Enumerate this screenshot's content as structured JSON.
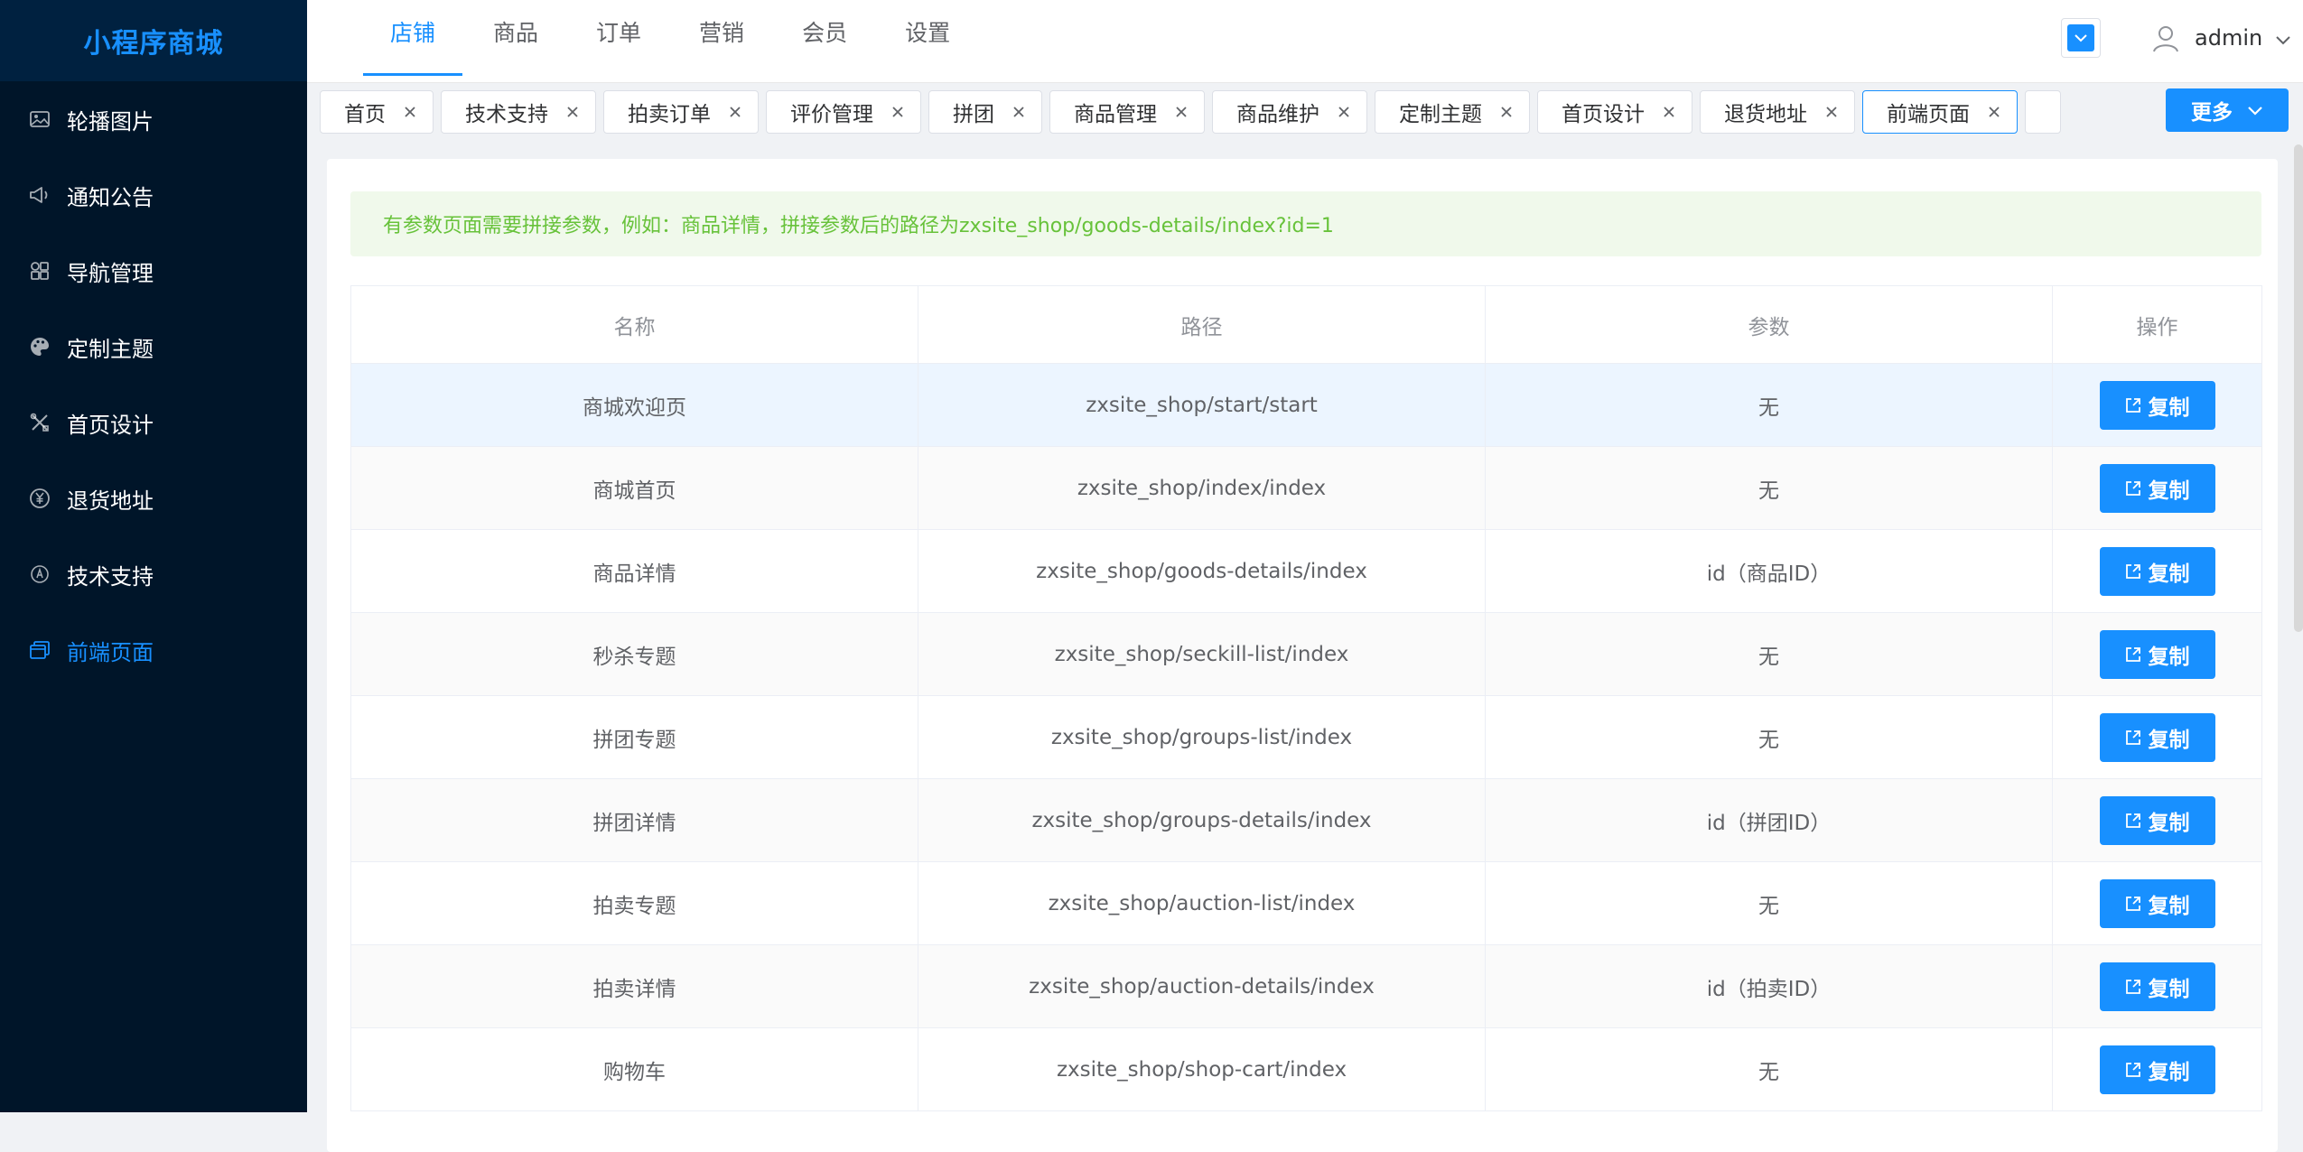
{
  "app": {
    "brand": "小程序商城"
  },
  "sidebar": {
    "items": [
      {
        "label": "轮播图片",
        "icon": "image-icon"
      },
      {
        "label": "通知公告",
        "icon": "megaphone-icon"
      },
      {
        "label": "导航管理",
        "icon": "grid-icon"
      },
      {
        "label": "定制主题",
        "icon": "palette-icon"
      },
      {
        "label": "首页设计",
        "icon": "tools-icon"
      },
      {
        "label": "退货地址",
        "icon": "yen-circle-icon"
      },
      {
        "label": "技术支持",
        "icon": "support-icon"
      },
      {
        "label": "前端页面",
        "icon": "windows-icon",
        "active": true
      }
    ]
  },
  "header": {
    "tabs": [
      {
        "label": "店铺",
        "active": true
      },
      {
        "label": "商品"
      },
      {
        "label": "订单"
      },
      {
        "label": "营销"
      },
      {
        "label": "会员"
      },
      {
        "label": "设置"
      }
    ],
    "user": "admin"
  },
  "tags": [
    {
      "label": "首页"
    },
    {
      "label": "技术支持"
    },
    {
      "label": "拍卖订单"
    },
    {
      "label": "评价管理"
    },
    {
      "label": "拼团"
    },
    {
      "label": "商品管理"
    },
    {
      "label": "商品维护"
    },
    {
      "label": "定制主题"
    },
    {
      "label": "首页设计"
    },
    {
      "label": "退货地址"
    },
    {
      "label": "前端页面",
      "active": true
    }
  ],
  "more_label": "更多",
  "notice": "有参数页面需要拼接参数，例如：商品详情，拼接参数后的路径为zxsite_shop/goods-details/index?id=1",
  "table": {
    "columns": [
      "名称",
      "路径",
      "参数",
      "操作"
    ],
    "copy_label": "复制",
    "rows": [
      {
        "name": "商城欢迎页",
        "path": "zxsite_shop/start/start",
        "param": "无"
      },
      {
        "name": "商城首页",
        "path": "zxsite_shop/index/index",
        "param": "无"
      },
      {
        "name": "商品详情",
        "path": "zxsite_shop/goods-details/index",
        "param": "id（商品ID）"
      },
      {
        "name": "秒杀专题",
        "path": "zxsite_shop/seckill-list/index",
        "param": "无"
      },
      {
        "name": "拼团专题",
        "path": "zxsite_shop/groups-list/index",
        "param": "无"
      },
      {
        "name": "拼团详情",
        "path": "zxsite_shop/groups-details/index",
        "param": "id（拼团ID）"
      },
      {
        "name": "拍卖专题",
        "path": "zxsite_shop/auction-list/index",
        "param": "无"
      },
      {
        "name": "拍卖详情",
        "path": "zxsite_shop/auction-details/index",
        "param": "id（拍卖ID）"
      },
      {
        "name": "购物车",
        "path": "zxsite_shop/shop-cart/index",
        "param": "无"
      }
    ]
  },
  "colors": {
    "sidebar_bg": "#001529",
    "brand_bg": "#002140",
    "accent": "#1890ff",
    "notice_bg": "#f0f9eb",
    "notice_text": "#67c23a"
  }
}
